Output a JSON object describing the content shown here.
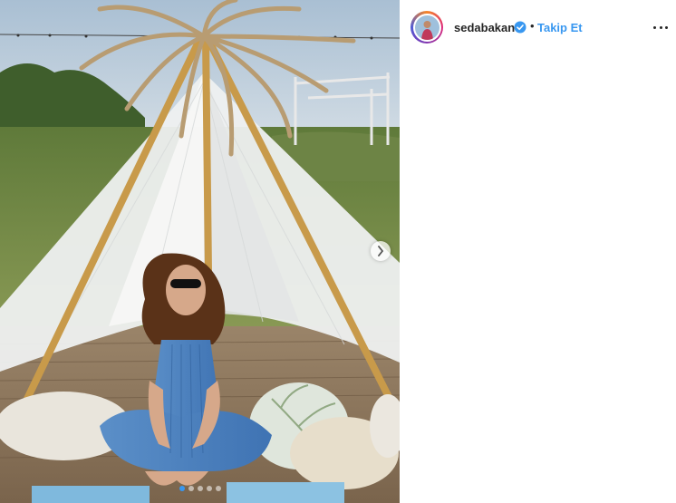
{
  "post": {
    "username": "sedabakan",
    "separator": "•",
    "follow_label": "Takip Et",
    "verified": true,
    "carousel": {
      "slide_count": 5,
      "active_slide": 1
    }
  },
  "icons": {
    "verified": "verified-badge-icon",
    "more": "more-options-icon",
    "next": "chevron-right-icon"
  },
  "colors": {
    "link_blue": "#3897f0",
    "text_dark": "#262626",
    "verified_blue": "#3897f0"
  }
}
